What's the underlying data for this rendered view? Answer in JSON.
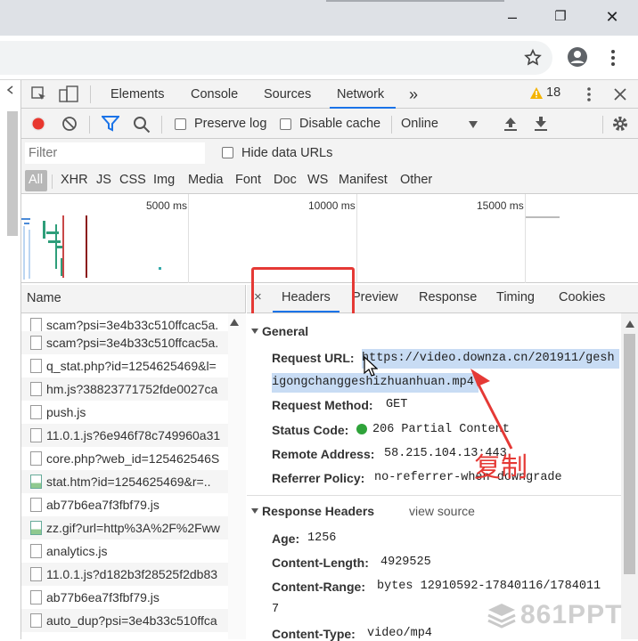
{
  "browser": {
    "minimize_glyph": "–",
    "restore_glyph": "❐",
    "close_glyph": "✕"
  },
  "devtools": {
    "tabs": [
      "Elements",
      "Console",
      "Sources",
      "Network"
    ],
    "more_tabs_glyph": "»",
    "warning_count": "18",
    "toolbar": {
      "preserve_log": "Preserve log",
      "disable_cache": "Disable cache",
      "throttle": "Online"
    },
    "filter": {
      "placeholder": "Filter",
      "hide_data_urls": "Hide data URLs"
    },
    "types": [
      "All",
      "XHR",
      "JS",
      "CSS",
      "Img",
      "Media",
      "Font",
      "Doc",
      "WS",
      "Manifest",
      "Other"
    ],
    "timeline": [
      "5000 ms",
      "10000 ms",
      "15000 ms"
    ]
  },
  "request_list": {
    "column": "Name",
    "rows": [
      {
        "name": "scam?psi=3e4b33c510ffcac5a.",
        "icon": "file"
      },
      {
        "name": "scam?psi=3e4b33c510ffcac5a.",
        "icon": "file"
      },
      {
        "name": "q_stat.php?id=1254625469&l=",
        "icon": "file"
      },
      {
        "name": "hm.js?38823771752fde0027ca",
        "icon": "file"
      },
      {
        "name": "push.js",
        "icon": "file"
      },
      {
        "name": "11.0.1.js?6e946f78c749960a31",
        "icon": "file"
      },
      {
        "name": "core.php?web_id=125462546S",
        "icon": "file"
      },
      {
        "name": "stat.htm?id=1254625469&r=..",
        "icon": "image"
      },
      {
        "name": "ab77b6ea7f3fbf79.js",
        "icon": "file"
      },
      {
        "name": "zz.gif?url=http%3A%2F%2Fww",
        "icon": "image"
      },
      {
        "name": "analytics.js",
        "icon": "file"
      },
      {
        "name": "11.0.1.js?d182b3f28525f2db83",
        "icon": "file"
      },
      {
        "name": "ab77b6ea7f3fbf79.js",
        "icon": "file"
      },
      {
        "name": "auto_dup?psi=3e4b33c510ffca",
        "icon": "file"
      }
    ]
  },
  "detail": {
    "close_glyph": "×",
    "tabs": [
      "Headers",
      "Preview",
      "Response",
      "Timing",
      "Cookies"
    ],
    "general": {
      "title": "General",
      "request_url_key": "Request URL:",
      "request_url_line1": "https://video.downza.cn/201911/gesh",
      "request_url_line2": "igongchanggeshizhuanhuan.mp4",
      "method_key": "Request Method:",
      "method": "GET",
      "status_key": "Status Code:",
      "status": "206 Partial Content",
      "remote_key": "Remote Address:",
      "remote": "58.215.104.13:443",
      "referrer_key": "Referrer Policy:",
      "referrer": "no-referrer-when-downgrade"
    },
    "response_headers": {
      "title": "Response Headers",
      "view_source": "view source",
      "age_key": "Age:",
      "age": "1256",
      "length_key": "Content-Length:",
      "length": "4929525",
      "range_key": "Content-Range:",
      "range_line1": "bytes 12910592-17840116/1784011",
      "range_line2": "7",
      "type_key": "Content-Type:",
      "type": "video/mp4"
    }
  },
  "annotation": {
    "label": "复制",
    "color": "#e53935"
  },
  "watermark": "861PPT"
}
